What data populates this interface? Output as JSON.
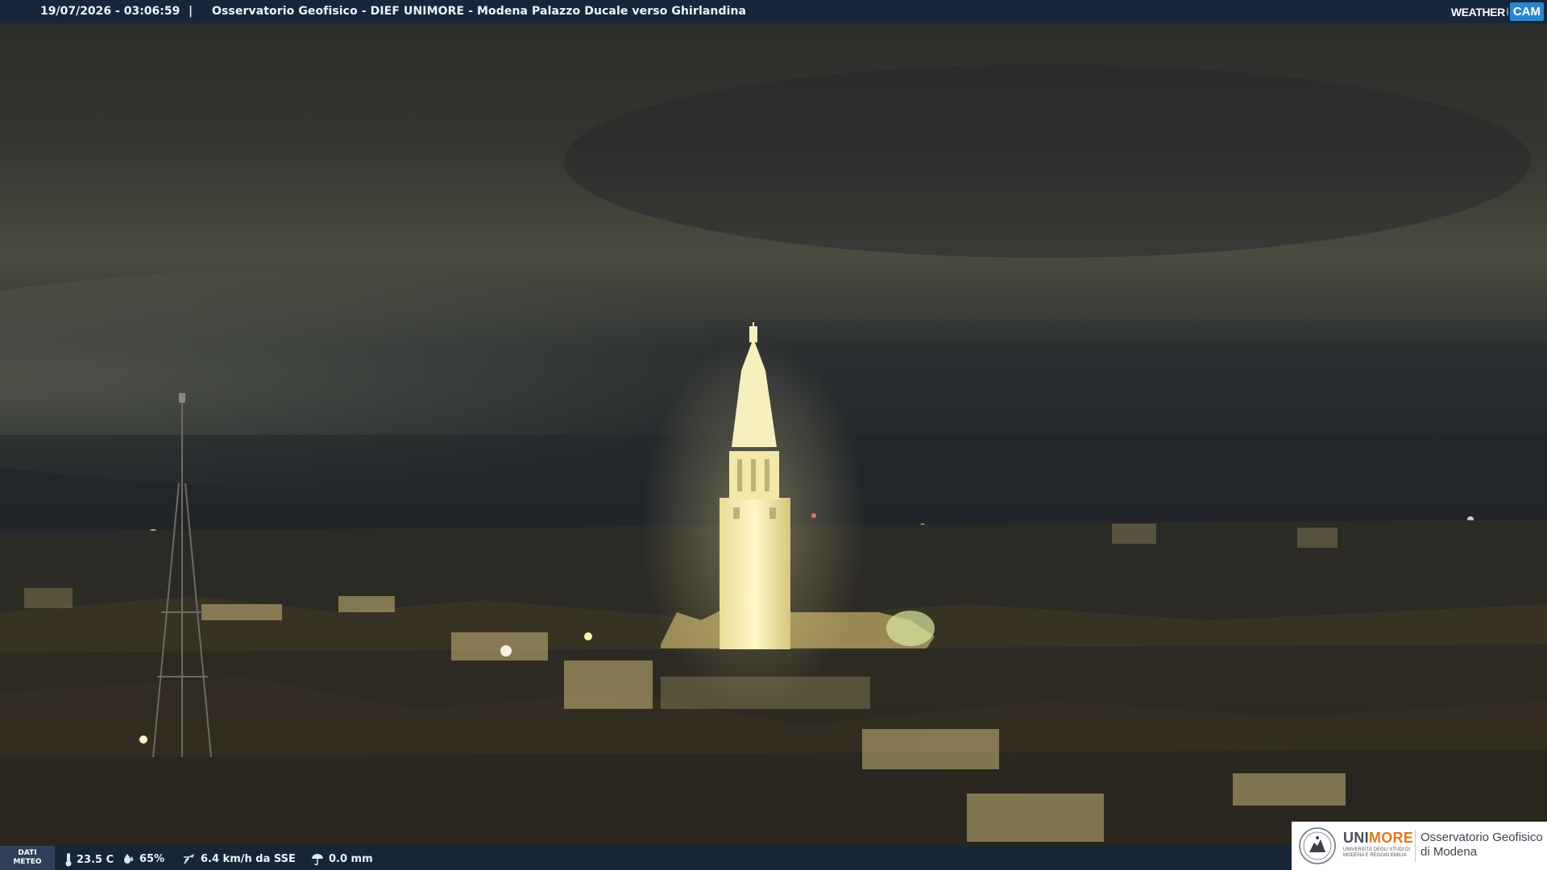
{
  "header": {
    "timestamp": "19/07/2026 - 03:06:59",
    "separator": "|",
    "title": "Osservatorio Geofisico - DIEF UNIMORE - Modena Palazzo Ducale verso Ghirlandina"
  },
  "brand": {
    "weather_text": "WEATHER",
    "cam_text": "CAM",
    "accent": "#2a86cf"
  },
  "weather": {
    "section_label_line1": "DATI",
    "section_label_line2": "METEO",
    "temperature": "23.5 C",
    "humidity": "65%",
    "wind": "6.4 km/h da SSE",
    "rain": "0.0 mm"
  },
  "institution": {
    "name_main": "UNI",
    "name_accent": "MORE",
    "subtitle": "UNIVERSITÀ DEGLI STUDI DI MODENA E REGGIO EMILIA",
    "observatory_line1": "Osservatorio Geofisico",
    "observatory_line2": "di Modena"
  },
  "colors": {
    "bar_bg": "#14263c",
    "sky": "#3a3c33",
    "tower_light": "#fff3b8"
  }
}
